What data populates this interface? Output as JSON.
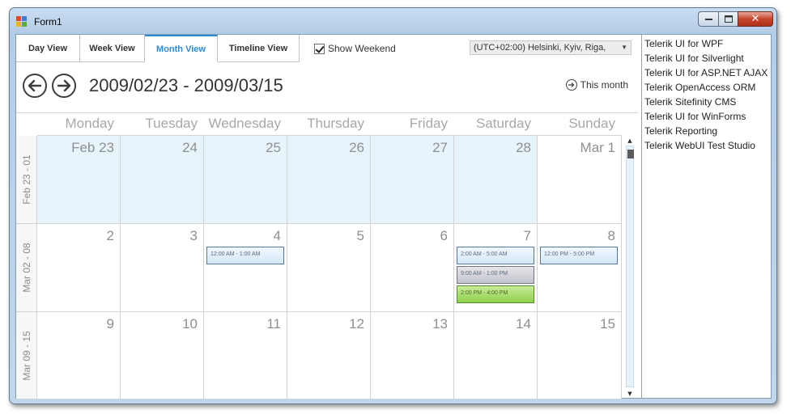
{
  "window": {
    "title": "Form1",
    "caption_close": "✕"
  },
  "scheduler": {
    "tabs": [
      {
        "label": "Day View"
      },
      {
        "label": "Week View"
      },
      {
        "label": "Month View"
      },
      {
        "label": "Timeline View"
      }
    ],
    "active_tab": "Month View",
    "show_weekend_label": "Show Weekend",
    "show_weekend_checked": true,
    "timezone": "(UTC+02:00) Helsinki, Kyiv, Riga,",
    "date_range": "2009/02/23 - 2009/03/15",
    "this_month_label": "This month",
    "day_headers": [
      "Monday",
      "Tuesday",
      "Wednesday",
      "Thursday",
      "Friday",
      "Saturday",
      "Sunday"
    ],
    "weeks": [
      {
        "label": "Feb 23 - 01",
        "days": [
          "Feb 23",
          "24",
          "25",
          "26",
          "27",
          "28",
          "Mar 1"
        ]
      },
      {
        "label": "Mar 02 - 08",
        "days": [
          "2",
          "3",
          "4",
          "5",
          "6",
          "7",
          "8"
        ]
      },
      {
        "label": "Mar 09 - 15",
        "days": [
          "9",
          "10",
          "11",
          "12",
          "13",
          "14",
          "15"
        ]
      }
    ],
    "appointments": {
      "wed_mar4": "12:00 AM - 1:00 AM",
      "sat_mar7_1": "2:00 AM - 5:00 AM",
      "sat_mar7_2": "9:00 AM - 1:00 PM",
      "sat_mar7_3": "2:00 PM - 4:00 PM",
      "sun_mar8": "12:00 PM - 5:00 PM"
    },
    "colors": {
      "accent": "#2b8bd6",
      "highlight_cell": "#e8f4fb",
      "appt_green": "#8ed04a"
    }
  },
  "list": {
    "items": [
      "Telerik UI for WPF",
      "Telerik UI for Silverlight",
      "Telerik UI for ASP.NET AJAX",
      "Telerik OpenAccess ORM",
      "Telerik Sitefinity CMS",
      "Telerik UI for WinForms",
      "Telerik Reporting",
      "Telerik WebUI Test Studio"
    ]
  }
}
